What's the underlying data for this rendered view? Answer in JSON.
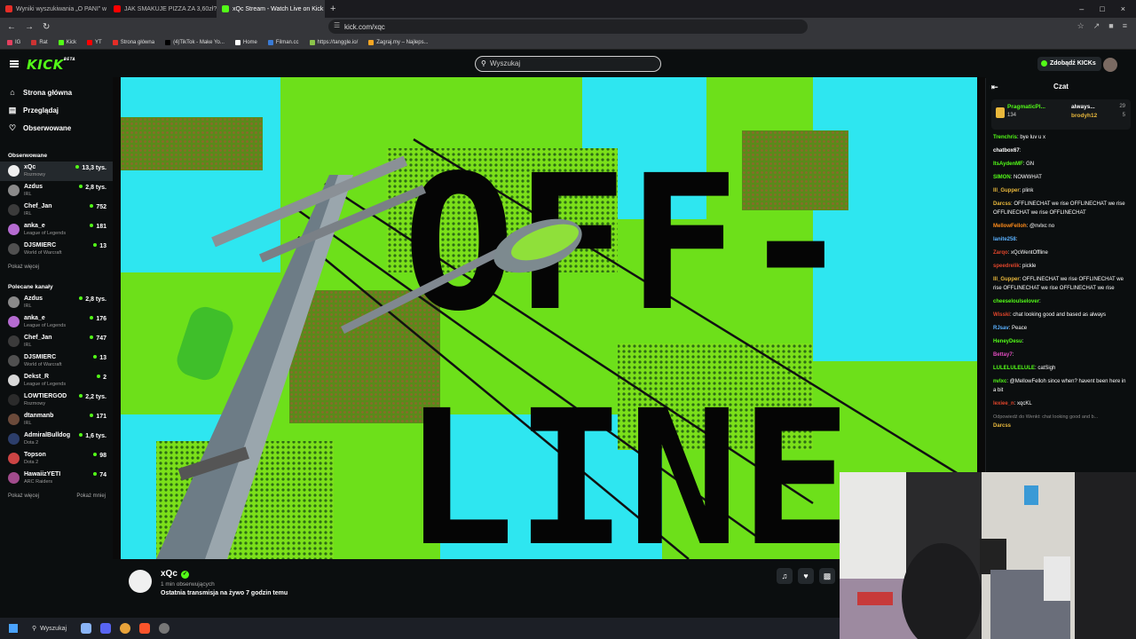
{
  "browser": {
    "tabs": [
      {
        "label": "Wyniki wyszukiwania „O PANI” w ser",
        "color": "#e52d27",
        "active": false
      },
      {
        "label": "JAK SMAKUJE PIZZA ZA 3,60zł? - You",
        "color": "#ff0000",
        "active": false
      },
      {
        "label": "xQc Stream - Watch Live on Kick",
        "color": "#53fc18",
        "active": true
      }
    ],
    "url": "kick.com/xqc",
    "bookmarks": [
      "IG",
      "Rat",
      "Kick",
      "YT",
      "Strona główna",
      "(4)TikTok - Make Yo...",
      "Home",
      "Filman.cc",
      "https://tanggle.io/",
      "Zagraj.my – Najleps..."
    ]
  },
  "header": {
    "logo": "KICK",
    "logo_sup": "BETA",
    "search_placeholder": "Wyszukaj",
    "get_kicks": "Zdobądź KICKs"
  },
  "sidebar": {
    "nav": [
      {
        "label": "Strona główna",
        "icon": "home-icon"
      },
      {
        "label": "Przeglądaj",
        "icon": "browse-icon"
      },
      {
        "label": "Obserwowane",
        "icon": "heart-icon"
      }
    ],
    "followed_title": "Obserwowane",
    "followed": [
      {
        "name": "xQc",
        "category": "Rozmowy",
        "viewers": "13,3 tys.",
        "color": "#f0f0f0"
      },
      {
        "name": "Azdus",
        "category": "IRL",
        "viewers": "2,8 tys.",
        "color": "#8a8a8a"
      },
      {
        "name": "Chef_Jan",
        "category": "IRL",
        "viewers": "752",
        "color": "#3b3b3b"
      },
      {
        "name": "anka_e",
        "category": "League of Legends",
        "viewers": "181",
        "color": "#b56bd1"
      },
      {
        "name": "DJSMIERC",
        "category": "World of Warcraft",
        "viewers": "13",
        "color": "#505050"
      }
    ],
    "show_more_1": "Pokaż więcej",
    "recommended_title": "Polecane kanały",
    "recommended": [
      {
        "name": "Azdus",
        "category": "IRL",
        "viewers": "2,8 tys.",
        "color": "#8a8a8a"
      },
      {
        "name": "anka_e",
        "category": "League of Legends",
        "viewers": "176",
        "color": "#b56bd1"
      },
      {
        "name": "Chef_Jan",
        "category": "IRL",
        "viewers": "747",
        "color": "#3b3b3b"
      },
      {
        "name": "DJSMIERC",
        "category": "World of Warcraft",
        "viewers": "13",
        "color": "#505050"
      },
      {
        "name": "Dekst_R",
        "category": "League of Legends",
        "viewers": "2",
        "color": "#d8d8d8"
      },
      {
        "name": "LOWTIERGOD",
        "category": "Rozmowy",
        "viewers": "2,2 tys.",
        "color": "#2b2b2b"
      },
      {
        "name": "dtanmanb",
        "category": "IRL",
        "viewers": "171",
        "color": "#6b4a3a"
      },
      {
        "name": "AdmiralBulldog",
        "category": "Dota 2",
        "viewers": "1,6 tys.",
        "color": "#2c3e6b"
      },
      {
        "name": "Topson",
        "category": "Dota 2",
        "viewers": "98",
        "color": "#c44"
      },
      {
        "name": "HawaiizYETI",
        "category": "ARC Raiders",
        "viewers": "74",
        "color": "#a14b8c"
      }
    ],
    "show_more_2": "Pokaż więcej",
    "show_less": "Pokaż mniej"
  },
  "player": {
    "offline_line1": "OFF-",
    "offline_line2": "LINE"
  },
  "channel": {
    "name": "xQc",
    "followers_ago": "1 min obserwujących",
    "last_stream": "Ostatnia transmisja na żywo 7 godzin temu"
  },
  "chat": {
    "title": "Czat",
    "pinned_user": "PragmaticPl...",
    "pinned_count": "134",
    "pinned_user2": "always...",
    "pinned_user2_count": "29",
    "pinned_user3": "brodyh12",
    "pinned_user3_count": "5",
    "messages": [
      {
        "user": "Trenchris",
        "color": "#53fc18",
        "text": ": bye luv u x"
      },
      {
        "user": "chatbox67",
        "color": "#ffffff",
        "text": ":"
      },
      {
        "user": "ItsAydenMF",
        "color": "#53fc18",
        "text": ": GN"
      },
      {
        "user": "SIMON",
        "color": "#53fc18",
        "text": ": NOWWHAT"
      },
      {
        "user": "Ill_Gupper",
        "color": "#e9b83c",
        "text": ": plink"
      },
      {
        "user": "Darcss",
        "color": "#e9b83c",
        "text": ": OFFLINECHAT we rise OFFLINECHAT we rise OFFLINECHAT we rise OFFLINECHAT"
      },
      {
        "user": "MellowFelloh",
        "color": "#ff8c1a",
        "text": ": @nvlxc no"
      },
      {
        "user": "lanite258",
        "color": "#5ab1ff",
        "text": ":"
      },
      {
        "user": "Zarqo",
        "color": "#e0452b",
        "text": ": xQcWentOffline"
      },
      {
        "user": "speedrelik",
        "color": "#e0452b",
        "text": ": pickle"
      },
      {
        "user": "Ill_Gupper",
        "color": "#e9b83c",
        "text": ": OFFLINECHAT we rise OFFLINECHAT we rise OFFLINECHAT we rise OFFLINECHAT we rise"
      },
      {
        "user": "cheeseloulselover",
        "color": "#53fc18",
        "text": ":"
      },
      {
        "user": "Wisski",
        "color": "#e0452b",
        "text": ": chat looking good and based as always"
      },
      {
        "user": "RJsav",
        "color": "#5ab1ff",
        "text": ": Peace"
      },
      {
        "user": "HeneyDesu",
        "color": "#53fc18",
        "text": ":"
      },
      {
        "user": "Bettay7",
        "color": "#e04bbf",
        "text": ":"
      },
      {
        "user": "LULELULELULE",
        "color": "#53fc18",
        "text": ": catSigh"
      },
      {
        "user": "nvlxc",
        "color": "#53fc18",
        "text": ": @MellowFelloh since when? havent been here in a bit"
      },
      {
        "user": "lexiee_n",
        "color": "#e0452b",
        "text": ": xqcKL"
      }
    ],
    "reply_note": "Odpowiedź do Wenkt: chat looking good and b...",
    "last_user": "Darcss"
  },
  "taskbar": {
    "search": "Wyszukaj"
  }
}
